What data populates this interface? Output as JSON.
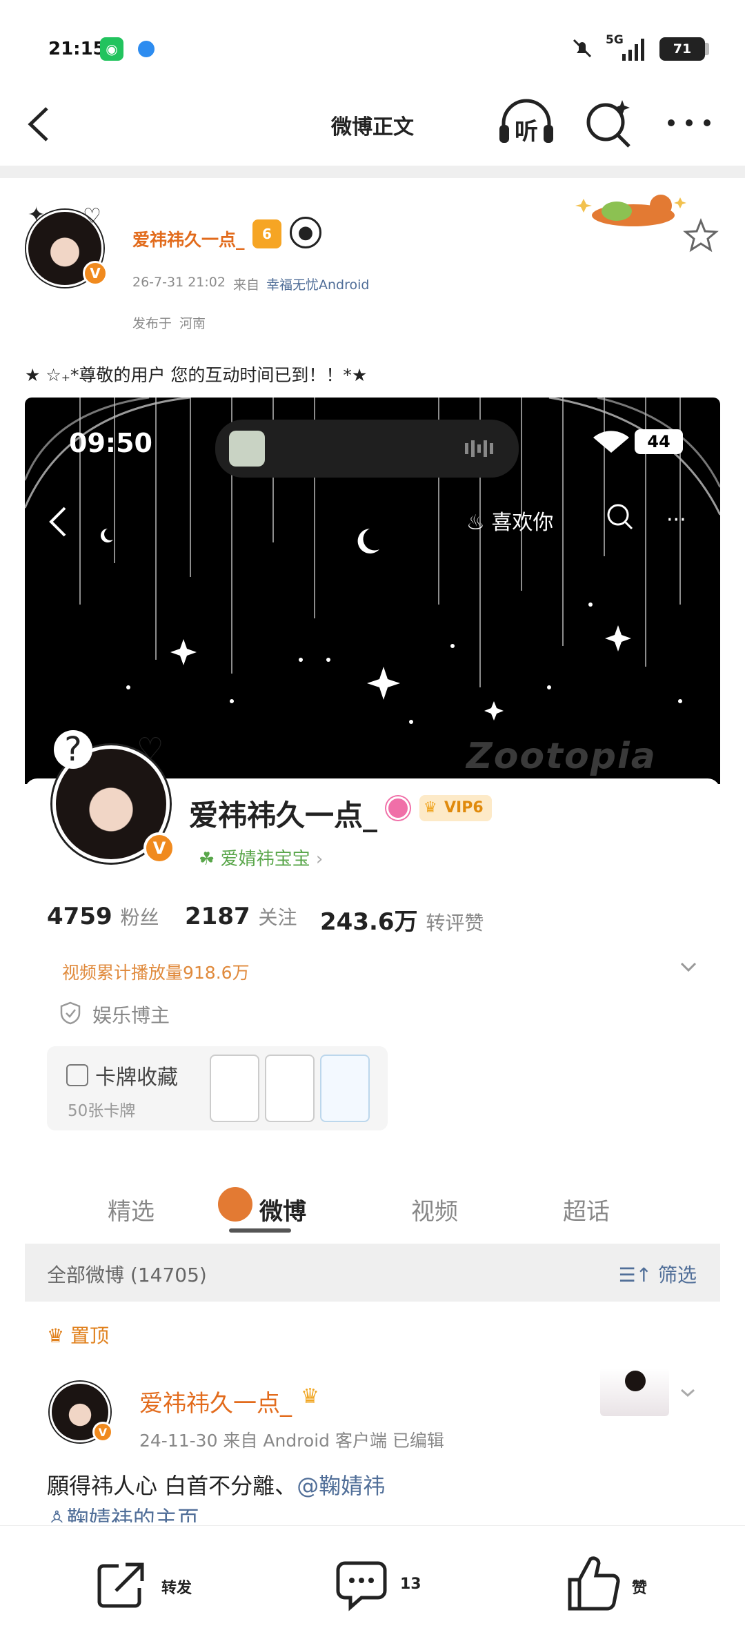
{
  "status_bar": {
    "time": "21:15",
    "battery": "71",
    "network": "5G"
  },
  "nav": {
    "title": "微博正文",
    "listen_label": "听"
  },
  "post": {
    "username": "爱祎祎久一点_",
    "vip_level": "6",
    "timestamp": "26-7-31 21:02",
    "from_prefix": "来自",
    "source": "幸福无忧Android",
    "location_prefix": "发布于",
    "location": "河南",
    "text": "★ ☆₊*尊敬的用户 您的互动时间已到！！*★"
  },
  "embedded": {
    "status_time": "09:50",
    "status_battery": "44",
    "like_you": "喜欢你",
    "brand": "Zootopia",
    "profile_name": "爱祎祎久一点_",
    "vip_tag": "VIP6",
    "group_label": "爱婧祎宝宝",
    "stats": [
      {
        "value": "4759",
        "label": "粉丝"
      },
      {
        "value": "2187",
        "label": "关注"
      },
      {
        "value": "243.6万",
        "label": "转评赞"
      }
    ],
    "video_plays": "视频累计播放量918.6万",
    "category": "娱乐博主",
    "card_title": "卡牌收藏",
    "card_count": "50张卡牌",
    "tabs": [
      "精选",
      "微博",
      "视频",
      "超话"
    ],
    "all_posts": "全部微博 (14705)",
    "filter": "筛选",
    "pinned": "置顶",
    "pinned_user": "爱祎祎久一点_",
    "pinned_meta": "24-11-30  来自 Android 客户端  已编辑",
    "pinned_text": "願得祎人心 白首不分離、",
    "mention": "@鞠婧祎",
    "homepage_link": "鞠婧祎的主页"
  },
  "bottom_bar": {
    "repost": "转发",
    "comment_count": "13",
    "like": "赞"
  },
  "colors": {
    "accent": "#e26b1c",
    "link": "#506e98"
  }
}
